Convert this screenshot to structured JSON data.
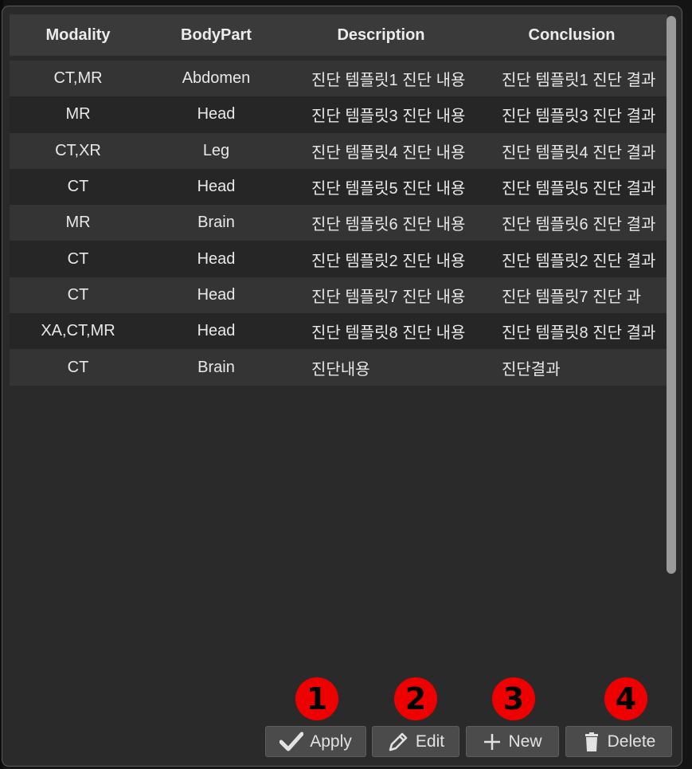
{
  "table": {
    "headers": [
      "Modality",
      "BodyPart",
      "Description",
      "Conclusion"
    ],
    "rows": [
      [
        "CT,MR",
        "Abdomen",
        "진단 템플릿1 진단 내용",
        "진단 템플릿1 진단 결과"
      ],
      [
        "MR",
        "Head",
        "진단 템플릿3 진단 내용",
        "진단 템플릿3 진단 결과"
      ],
      [
        "CT,XR",
        "Leg",
        "진단 템플릿4 진단 내용",
        "진단 템플릿4 진단 결과"
      ],
      [
        "CT",
        "Head",
        "진단 템플릿5 진단 내용",
        "진단 템플릿5 진단 결과"
      ],
      [
        "MR",
        "Brain",
        "진단 템플릿6 진단 내용",
        "진단 템플릿6 진단 결과"
      ],
      [
        "CT",
        "Head",
        "진단 템플릿2 진단 내용",
        "진단 템플릿2 진단 결과"
      ],
      [
        "CT",
        "Head",
        "진단 템플릿7 진단 내용",
        "진단 템플릿7 진단 과"
      ],
      [
        "XA,CT,MR",
        "Head",
        "진단 템플릿8 진단 내용",
        "진단 템플릿8 진단 결과"
      ],
      [
        "CT",
        "Brain",
        "진단내용",
        "진단결과"
      ]
    ]
  },
  "markers": [
    "1",
    "2",
    "3",
    "4"
  ],
  "buttons": {
    "apply": "Apply",
    "edit": "Edit",
    "new": "New",
    "delete": "Delete"
  },
  "icons": {
    "apply": "check-icon",
    "edit": "pencil-icon",
    "new": "plus-icon",
    "delete": "trash-icon"
  },
  "colors": {
    "marker": "#ee0000",
    "panel": "#2a2a2a",
    "header": "#3a3a3a"
  }
}
